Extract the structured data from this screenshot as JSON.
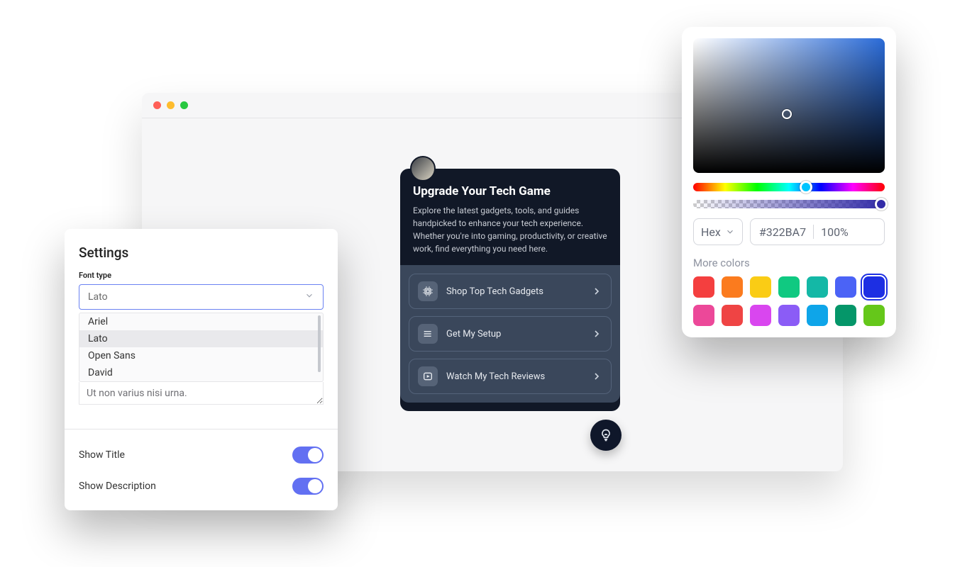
{
  "settings": {
    "title": "Settings",
    "font_type_label": "Font type",
    "font_type_value": "Lato",
    "font_options": [
      "Ariel",
      "Lato",
      "Open Sans",
      "David"
    ],
    "textarea_value": "Ut non varius nisi urna.",
    "show_title_label": "Show Title",
    "show_title_on": true,
    "show_description_label": "Show Description",
    "show_description_on": true
  },
  "upgrade": {
    "title": "Upgrade Your Tech Game",
    "description": "Explore the latest gadgets, tools, and guides handpicked to enhance your tech experience. Whether you're into gaming, productivity, or creative work, find everything you need here.",
    "items": [
      {
        "icon": "cpu-icon",
        "label": "Shop Top Tech Gadgets"
      },
      {
        "icon": "layout-icon",
        "label": "Get My Setup"
      },
      {
        "icon": "play-icon",
        "label": "Watch My Tech Reviews"
      }
    ]
  },
  "color_picker": {
    "mode": "Hex",
    "hex": "#322BA7",
    "opacity": "100%",
    "more_colors_label": "More colors",
    "swatches_row1": [
      "#f43f3f",
      "#fb7b1e",
      "#facc15",
      "#10c981",
      "#14b8a6",
      "#4b63f6",
      "#1d2fe3"
    ],
    "swatches_row2": [
      "#ec4899",
      "#ef4444",
      "#d946ef",
      "#8b5cf6",
      "#0ea5e9",
      "#059669",
      "#65c71a"
    ],
    "selected_swatch": "#1d2fe3"
  }
}
